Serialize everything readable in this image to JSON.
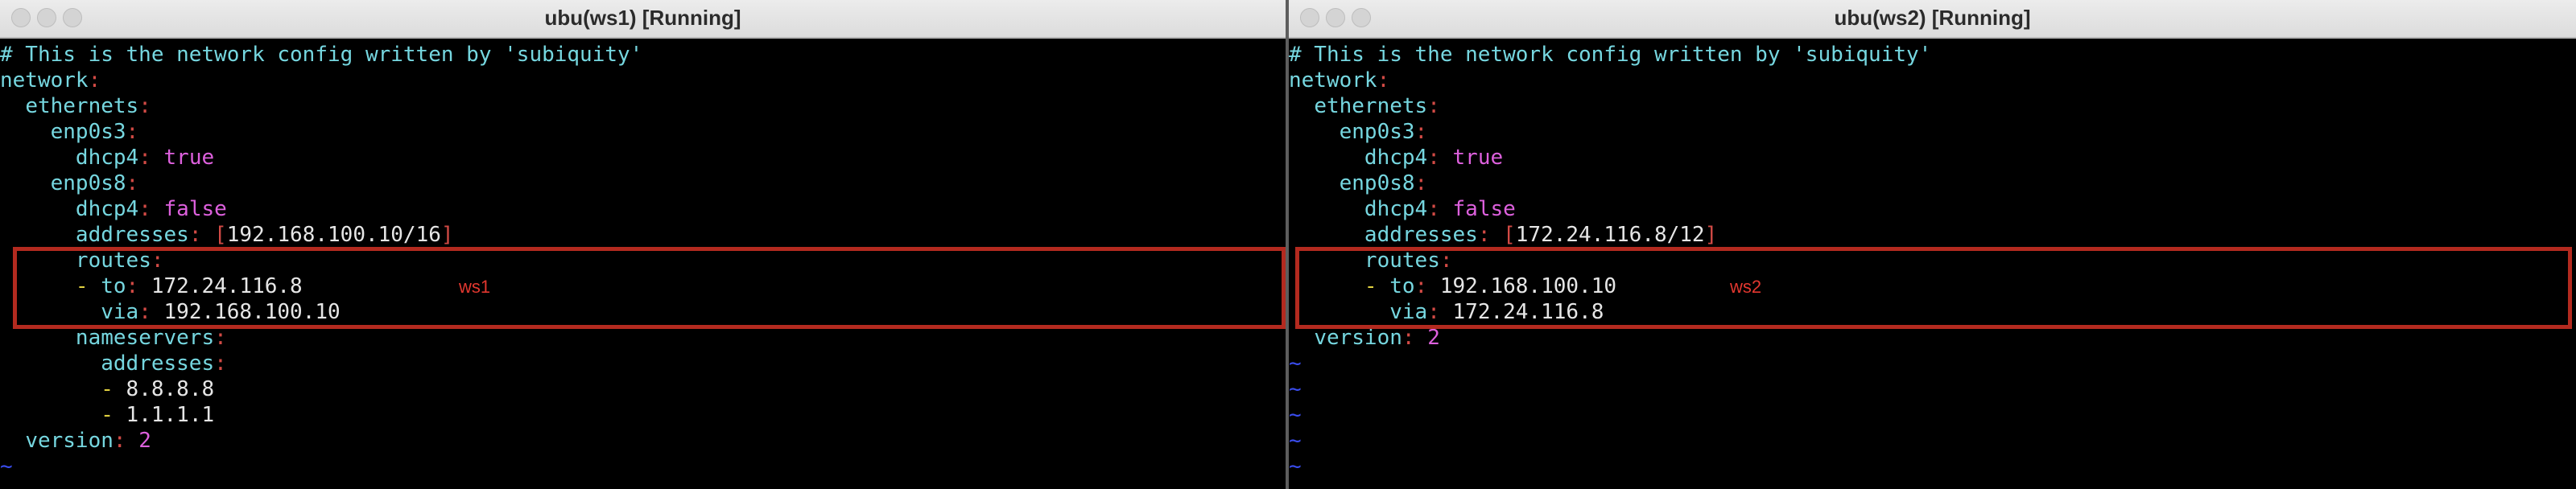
{
  "window1": {
    "title": "ubu(ws1) [Running]",
    "comment": "# This is the network config written by 'subiquity'",
    "network_key": "network",
    "ethernets_key": "ethernets",
    "iface1": "enp0s3",
    "dhcp4_key": "dhcp4",
    "iface1_dhcp4": "true",
    "iface2": "enp0s8",
    "iface2_dhcp4": "false",
    "addresses_key": "addresses",
    "address": "192.168.100.10/16",
    "routes_key": "routes",
    "to_key": "to",
    "route_to": "172.24.116.8",
    "via_key": "via",
    "route_via": "192.168.100.10",
    "annotation": "ws1",
    "nameservers_key": "nameservers",
    "ns_addresses_key": "addresses",
    "dns": [
      "8.8.8.8",
      "1.1.1.1"
    ],
    "version_key": "version",
    "version_value": "2",
    "tilde": "~"
  },
  "window2": {
    "title": "ubu(ws2) [Running]",
    "comment": "# This is the network config written by 'subiquity'",
    "network_key": "network",
    "ethernets_key": "ethernets",
    "iface1": "enp0s3",
    "dhcp4_key": "dhcp4",
    "iface1_dhcp4": "true",
    "iface2": "enp0s8",
    "iface2_dhcp4": "false",
    "addresses_key": "addresses",
    "address": "172.24.116.8/12",
    "routes_key": "routes",
    "to_key": "to",
    "route_to": "192.168.100.10",
    "via_key": "via",
    "route_via": "172.24.116.8",
    "annotation": "ws2",
    "version_key": "version",
    "version_value": "2",
    "tilde": "~"
  },
  "colors": {
    "key": "#76d7e0",
    "punctuation": "#d24a45",
    "value": "#dd60dd",
    "dash": "#e0d040",
    "tilde": "#3a4df0",
    "highlight_box": "#b32a1f"
  }
}
